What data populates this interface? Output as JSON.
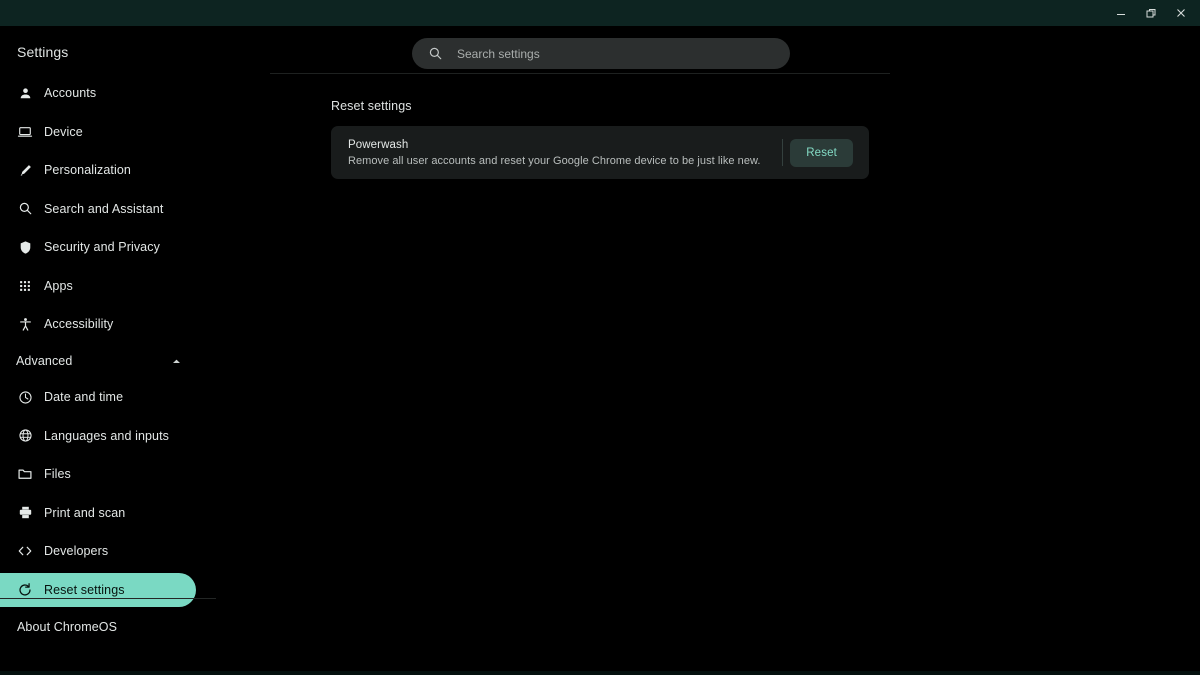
{
  "window": {
    "controls": [
      {
        "name": "minimize",
        "label": "Minimize"
      },
      {
        "name": "restore",
        "label": "Restore"
      },
      {
        "name": "close",
        "label": "Close"
      }
    ]
  },
  "search": {
    "placeholder": "Search settings",
    "value": "",
    "icon": "search-icon"
  },
  "sidebar": {
    "title": "Settings",
    "items": [
      {
        "label": "Accounts",
        "icon": "person-icon",
        "active": false
      },
      {
        "label": "Device",
        "icon": "laptop-icon",
        "active": false
      },
      {
        "label": "Personalization",
        "icon": "pen-icon",
        "active": false
      },
      {
        "label": "Search and Assistant",
        "icon": "search-icon",
        "active": false
      },
      {
        "label": "Security and Privacy",
        "icon": "shield-icon",
        "active": false
      },
      {
        "label": "Apps",
        "icon": "grid-icon",
        "active": false
      },
      {
        "label": "Accessibility",
        "icon": "accessibility-icon",
        "active": false
      }
    ],
    "advanced": {
      "label": "Advanced",
      "expanded": true,
      "chevron": "chevron-up-icon",
      "items": [
        {
          "label": "Date and time",
          "icon": "clock-icon",
          "active": false
        },
        {
          "label": "Languages and inputs",
          "icon": "globe-icon",
          "active": false
        },
        {
          "label": "Files",
          "icon": "folder-icon",
          "active": false
        },
        {
          "label": "Print and scan",
          "icon": "printer-icon",
          "active": false
        },
        {
          "label": "Developers",
          "icon": "code-icon",
          "active": false
        },
        {
          "label": "Reset settings",
          "icon": "reset-icon",
          "active": true
        }
      ]
    },
    "about": {
      "label": "About ChromeOS"
    }
  },
  "main": {
    "section_title": "Reset settings",
    "powerwash": {
      "title": "Powerwash",
      "description": "Remove all user accounts and reset your Google Chrome device to be just like new.",
      "button_label": "Reset"
    }
  },
  "colors": {
    "titlebar": "#0d2421",
    "page_bg": "#000000",
    "accent_pill": "#7ad9c3",
    "accent_text": "#84dcc6",
    "button_bg": "#2b3b38",
    "card_bg": "#191c1c",
    "search_bg": "#2c2f2f"
  }
}
